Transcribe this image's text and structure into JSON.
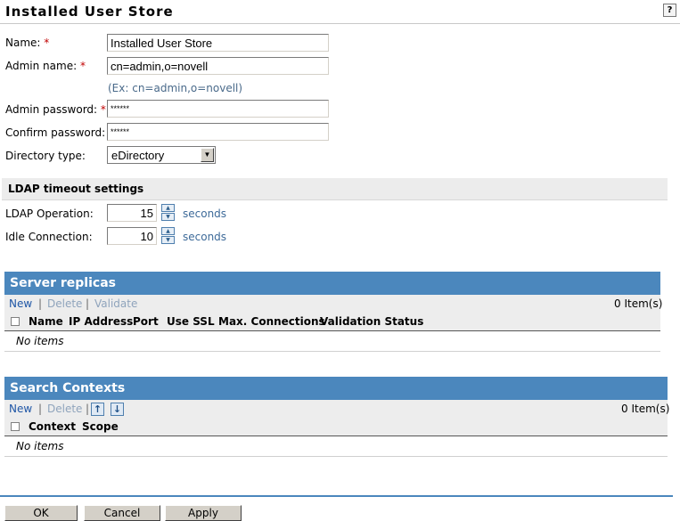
{
  "page": {
    "title": "Installed User Store",
    "help_label": "?"
  },
  "form": {
    "name_label": "Name:",
    "name_value": "Installed User Store",
    "admin_name_label": "Admin name:",
    "admin_name_value": "cn=admin,o=novell",
    "admin_name_hint": "(Ex: cn=admin,o=novell)",
    "admin_password_label": "Admin password:",
    "admin_password_value": "******",
    "confirm_password_label": "Confirm password:",
    "confirm_password_value": "******",
    "directory_type_label": "Directory type:",
    "directory_type_value": "eDirectory",
    "required_mark": "*"
  },
  "ldap": {
    "section_title": "LDAP timeout settings",
    "operation_label": "LDAP Operation:",
    "operation_value": "15",
    "idle_label": "Idle Connection:",
    "idle_value": "10",
    "unit": "seconds"
  },
  "replicas": {
    "title": "Server replicas",
    "new": "New",
    "delete": "Delete",
    "validate": "Validate",
    "separator": "|",
    "count": "0 Item(s)",
    "columns": [
      "Name",
      "IP Address",
      "Port",
      "Use SSL",
      "Max. Connections",
      "Validation Status"
    ],
    "empty": "No items"
  },
  "contexts": {
    "title": "Search Contexts",
    "new": "New",
    "delete": "Delete",
    "separator": "|",
    "count": "0 Item(s)",
    "columns": [
      "Context",
      "Scope"
    ],
    "empty": "No items"
  },
  "buttons": {
    "ok": "OK",
    "cancel": "Cancel",
    "apply": "Apply"
  },
  "colors": {
    "accent": "#4b87bd",
    "required": "#c00000",
    "link": "#1f56a6"
  }
}
